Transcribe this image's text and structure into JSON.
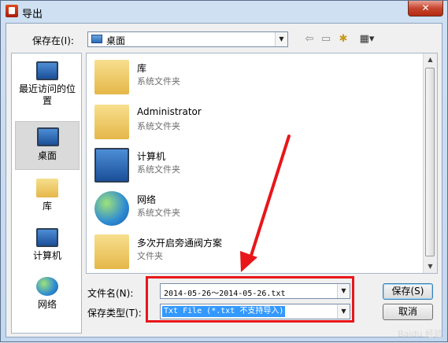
{
  "window": {
    "title": "导出",
    "close_glyph": "✕"
  },
  "toolbar": {
    "save_in_label": "保存在(I):",
    "save_in_value": "桌面",
    "back_glyph": "⇦",
    "up_glyph": "▭",
    "new_folder_glyph": "✱",
    "view_glyph": "▦▾"
  },
  "places": [
    {
      "label": "最近访问的位置",
      "icon": "recent-places-icon"
    },
    {
      "label": "桌面",
      "icon": "desktop-icon",
      "selected": true
    },
    {
      "label": "库",
      "icon": "libraries-icon"
    },
    {
      "label": "计算机",
      "icon": "computer-icon"
    },
    {
      "label": "网络",
      "icon": "network-icon"
    }
  ],
  "files": [
    {
      "name": "库",
      "type": "系统文件夹",
      "icon": "libraries-icon"
    },
    {
      "name": "Administrator",
      "type": "系统文件夹",
      "icon": "user-folder-icon"
    },
    {
      "name": "计算机",
      "type": "系统文件夹",
      "icon": "computer-icon"
    },
    {
      "name": "网络",
      "type": "系统文件夹",
      "icon": "network-icon"
    },
    {
      "name": "多次开启旁通阀方案",
      "type": "文件夹",
      "icon": "folder-icon"
    }
  ],
  "form": {
    "filename_label": "文件名(N):",
    "filename_value": "2014-05-26～2014-05-26.txt",
    "filetype_label": "保存类型(T):",
    "filetype_value": "Txt File (*.txt 不支持导入)",
    "save_button": "保存(S)",
    "cancel_button": "取消"
  },
  "annotation": {
    "color": "#e8161a"
  },
  "watermark": "Baidu 经验"
}
